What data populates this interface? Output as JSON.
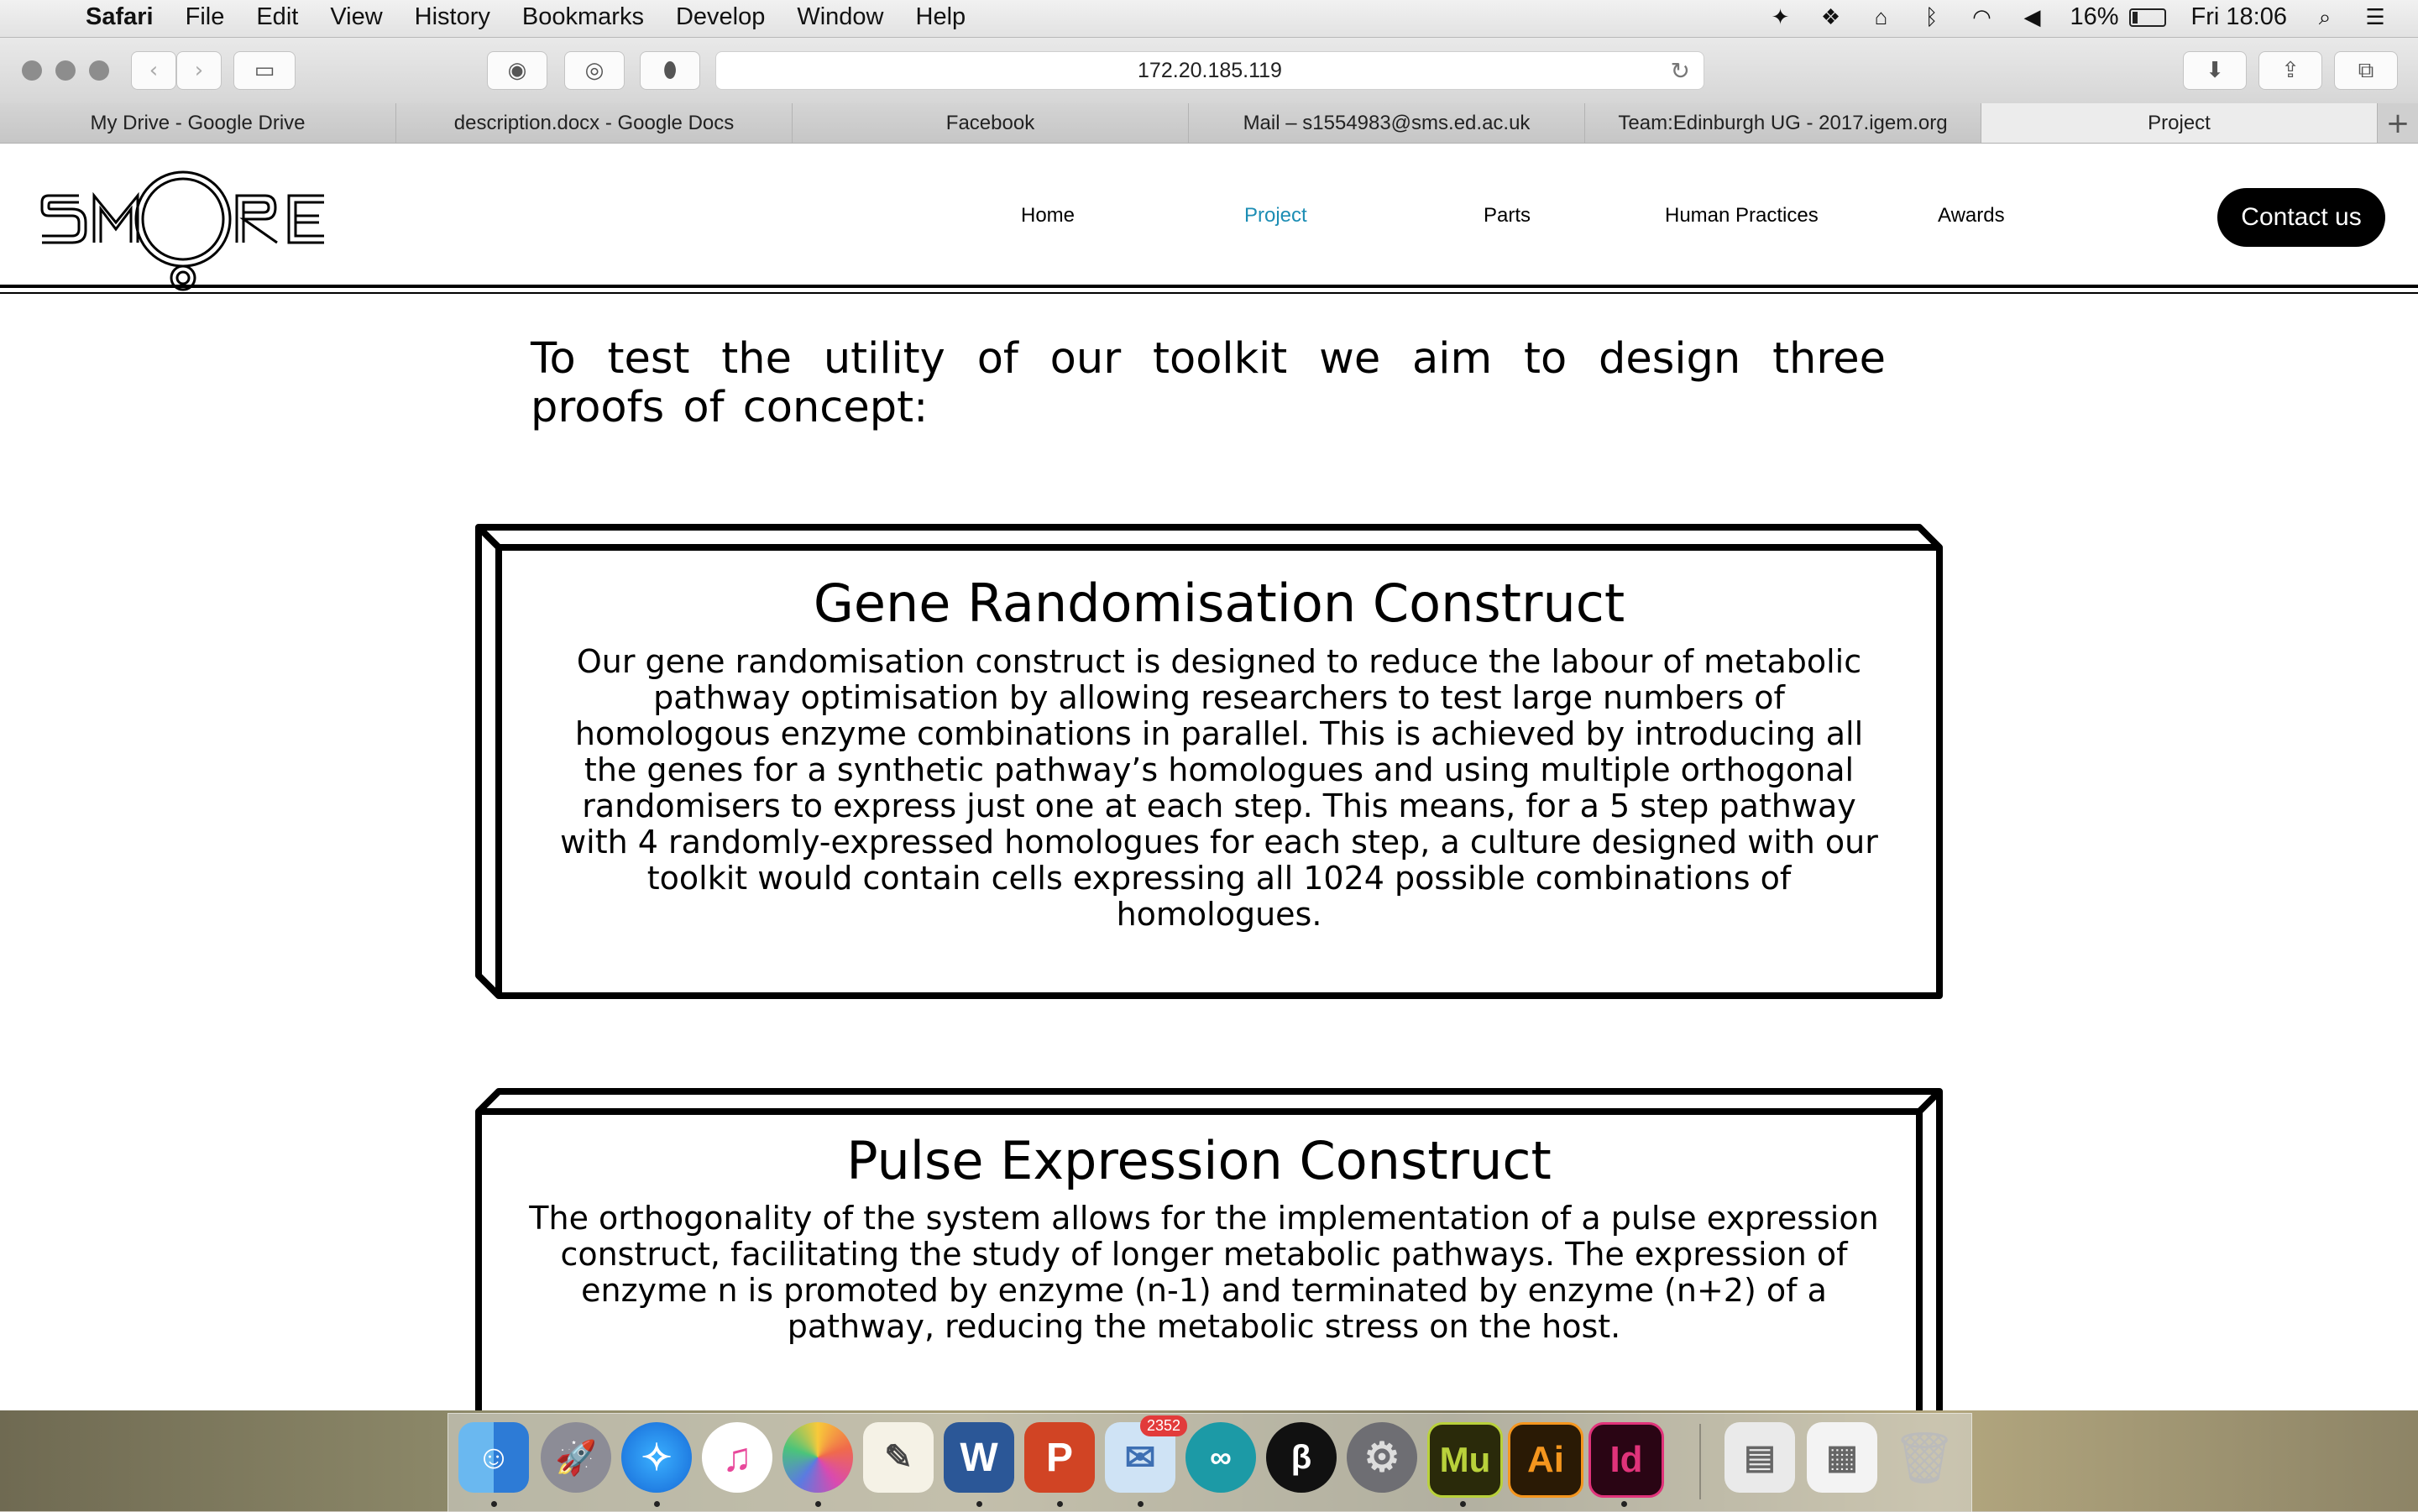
{
  "menubar": {
    "app": "Safari",
    "items": [
      "File",
      "Edit",
      "View",
      "History",
      "Bookmarks",
      "Develop",
      "Window",
      "Help"
    ],
    "battery": "16%",
    "clock": "Fri 18:06"
  },
  "browser": {
    "url": "172.20.185.119",
    "tabs": [
      {
        "label": "My Drive - Google Drive"
      },
      {
        "label": "description.docx - Google Docs"
      },
      {
        "label": "Facebook"
      },
      {
        "label": "Mail – s1554983@sms.ed.ac.uk"
      },
      {
        "label": "Team:Edinburgh UG - 2017.igem.org"
      },
      {
        "label": "Project"
      }
    ]
  },
  "site": {
    "logo": "SMORE",
    "nav": [
      "Home",
      "Project",
      "Parts",
      "Human Practices",
      "Awards"
    ],
    "contact": "Contact us",
    "intro": "To test the utility of our toolkit we aim to design three proofs of concept:",
    "constructs": [
      {
        "title": "Gene Randomisation Construct",
        "body": "Our gene randomisation construct is designed to reduce the labour of metabolic pathway optimisation by allowing researchers to test large numbers of homologous enzyme combinations in parallel. This is achieved by introducing all the genes for a synthetic pathway’s homologues and using multiple orthogonal randomisers to express just one at each step. This means, for a 5 step pathway with 4 randomly-expressed homologues for each step, a culture designed with our toolkit would contain cells expressing all 1024 possible combinations of homologues."
      },
      {
        "title": "Pulse Expression Construct",
        "body": "The orthogonality of the system allows for the implementation of a pulse expression construct, facilitating the study of longer metabolic pathways. The expression of enzyme n is promoted by enzyme (n-1) and terminated by enzyme (n+2) of a pathway, reducing the metabolic stress on the host."
      }
    ]
  },
  "dock": {
    "mail_badge": "2352",
    "apps": [
      "Finder",
      "Launchpad",
      "Safari",
      "iTunes",
      "Photos",
      "TextEdit",
      "Word",
      "PowerPoint",
      "Mail",
      "Arduino",
      "Fiji",
      "System Preferences",
      "Mu",
      "Ai",
      "Id",
      "Documents",
      "Downloads",
      "Trash"
    ]
  },
  "colors": {
    "nav_active": "#1c8db4",
    "contact_bg": "#000000"
  }
}
